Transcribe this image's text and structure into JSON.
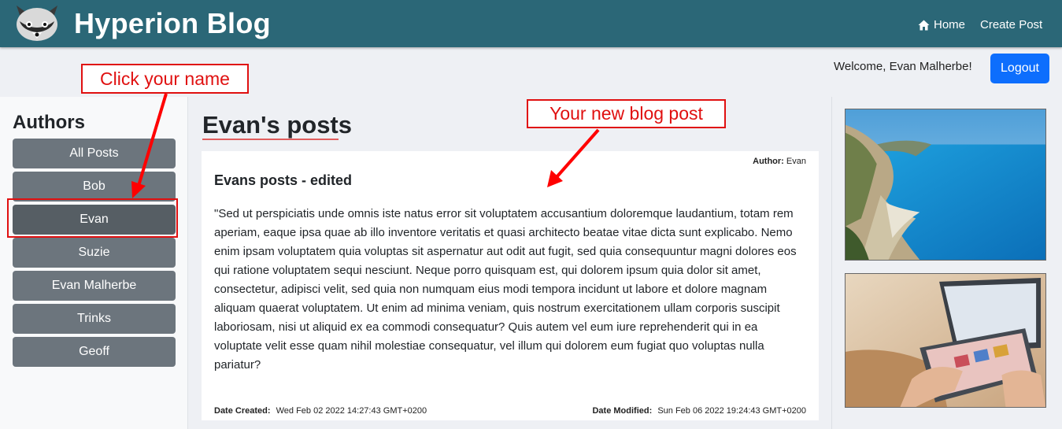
{
  "navbar": {
    "brand": "Hyperion Blog",
    "home_label": "Home",
    "create_label": "Create Post",
    "color": "#2b6777"
  },
  "user": {
    "welcome": "Welcome, Evan Malherbe!",
    "logout_label": "Logout"
  },
  "sidebar": {
    "title": "Authors",
    "authors": [
      {
        "label": "All Posts"
      },
      {
        "label": "Bob"
      },
      {
        "label": "Evan",
        "active": true
      },
      {
        "label": "Suzie"
      },
      {
        "label": "Evan Malherbe"
      },
      {
        "label": "Trinks"
      },
      {
        "label": "Geoff"
      }
    ]
  },
  "main": {
    "page_title": "Evan's posts",
    "post": {
      "author_label": "Author:",
      "author_value": "Evan",
      "title": "Evans posts - edited",
      "body": "\"Sed ut perspiciatis unde omnis iste natus error sit voluptatem accusantium doloremque laudantium, totam rem aperiam, eaque ipsa quae ab illo inventore veritatis et quasi architecto beatae vitae dicta sunt explicabo. Nemo enim ipsam voluptatem quia voluptas sit aspernatur aut odit aut fugit, sed quia consequuntur magni dolores eos qui ratione voluptatem sequi nesciunt. Neque porro quisquam est, qui dolorem ipsum quia dolor sit amet, consectetur, adipisci velit, sed quia non numquam eius modi tempora incidunt ut labore et dolore magnam aliquam quaerat voluptatem. Ut enim ad minima veniam, quis nostrum exercitationem ullam corporis suscipit laboriosam, nisi ut aliquid ex ea commodi consequatur? Quis autem vel eum iure reprehenderit qui in ea voluptate velit esse quam nihil molestiae consequatur, vel illum qui dolorem eum fugiat quo voluptas nulla pariatur?",
      "date_created_label": "Date Created:",
      "date_created_value": "Wed Feb 02 2022 14:27:43 GMT+0200",
      "date_modified_label": "Date Modified:",
      "date_modified_value": "Sun Feb 06 2022 19:24:43 GMT+0200"
    }
  },
  "annotations": {
    "click_name": "Click your name",
    "new_post": "Your new blog post",
    "color": "#e01010"
  },
  "images": [
    {
      "subject": "beach-cove-image"
    },
    {
      "subject": "tablet-laptop-image"
    }
  ]
}
